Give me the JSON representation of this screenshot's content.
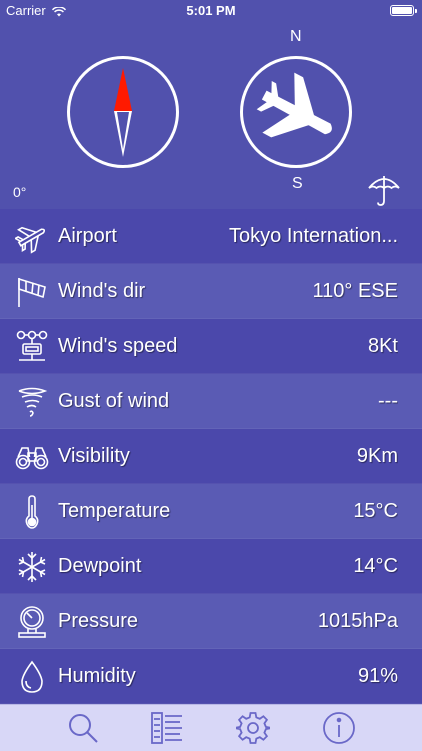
{
  "status": {
    "carrier": "Carrier",
    "time": "5:01 PM"
  },
  "compass": {
    "north": "N",
    "south": "S",
    "heading": "0°"
  },
  "rows": [
    {
      "icon": "airplane-icon",
      "name": "Airport",
      "value": "Tokyo Internation..."
    },
    {
      "icon": "windsock-icon",
      "name": "Wind's dir",
      "value": "110° ESE"
    },
    {
      "icon": "anemometer-icon",
      "name": "Wind's speed",
      "value": "8Kt"
    },
    {
      "icon": "tornado-icon",
      "name": "Gust of wind",
      "value": "---"
    },
    {
      "icon": "binoculars-icon",
      "name": "Visibility",
      "value": "9Km"
    },
    {
      "icon": "thermometer-icon",
      "name": "Temperature",
      "value": "15°C"
    },
    {
      "icon": "snowflake-icon",
      "name": "Dewpoint",
      "value": "14°C"
    },
    {
      "icon": "barometer-icon",
      "name": "Pressure",
      "value": "1015hPa"
    },
    {
      "icon": "droplet-icon",
      "name": "Humidity",
      "value": "91%"
    }
  ],
  "tabs": [
    {
      "icon": "search-icon"
    },
    {
      "icon": "list-icon"
    },
    {
      "icon": "gear-icon"
    },
    {
      "icon": "info-icon"
    }
  ],
  "colors": {
    "background": "#5151ad",
    "tabbar": "#d8d7f7",
    "tab_icon": "#6a68c8",
    "needle_red": "#ff1a00"
  }
}
